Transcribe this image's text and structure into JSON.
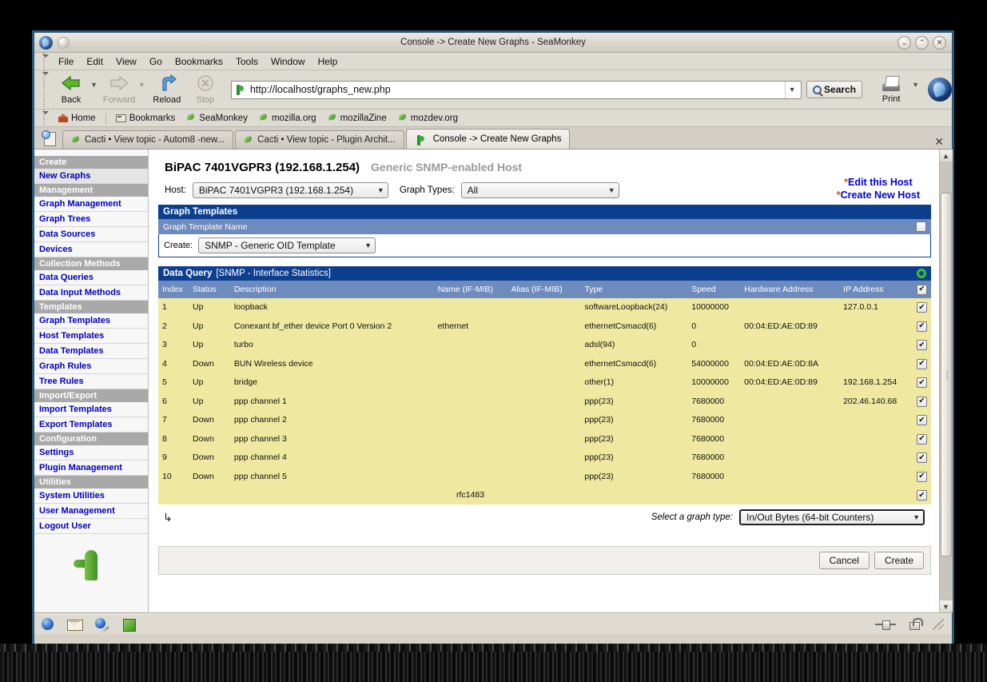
{
  "window": {
    "title": "Console -> Create New Graphs - SeaMonkey",
    "buttons": {
      "minimize": "⌄",
      "maximize": "⌃",
      "close": "✕"
    }
  },
  "menubar": {
    "items": [
      "File",
      "Edit",
      "View",
      "Go",
      "Bookmarks",
      "Tools",
      "Window",
      "Help"
    ]
  },
  "toolbar": {
    "back": "Back",
    "forward": "Forward",
    "reload": "Reload",
    "stop": "Stop",
    "url": "http://localhost/graphs_new.php",
    "search": "Search",
    "print": "Print"
  },
  "bookmarks": {
    "items": [
      "Home",
      "Bookmarks",
      "SeaMonkey",
      "mozilla.org",
      "mozillaZine",
      "mozdev.org"
    ]
  },
  "tabs": [
    {
      "label": "Cacti • View topic - Autom8 -new...",
      "active": false
    },
    {
      "label": "Cacti • View topic - Plugin Archit...",
      "active": false
    },
    {
      "label": "Console -> Create New Graphs",
      "active": true
    }
  ],
  "sidebar": {
    "items": [
      {
        "label": "Create",
        "type": "header"
      },
      {
        "label": "New Graphs",
        "type": "link",
        "current": true
      },
      {
        "label": "Management",
        "type": "header"
      },
      {
        "label": "Graph Management",
        "type": "link"
      },
      {
        "label": "Graph Trees",
        "type": "link"
      },
      {
        "label": "Data Sources",
        "type": "link"
      },
      {
        "label": "Devices",
        "type": "link"
      },
      {
        "label": "Collection Methods",
        "type": "header"
      },
      {
        "label": "Data Queries",
        "type": "link"
      },
      {
        "label": "Data Input Methods",
        "type": "link"
      },
      {
        "label": "Templates",
        "type": "header"
      },
      {
        "label": "Graph Templates",
        "type": "link"
      },
      {
        "label": "Host Templates",
        "type": "link"
      },
      {
        "label": "Data Templates",
        "type": "link"
      },
      {
        "label": "Graph Rules",
        "type": "link"
      },
      {
        "label": "Tree Rules",
        "type": "link"
      },
      {
        "label": "Import/Export",
        "type": "header"
      },
      {
        "label": "Import Templates",
        "type": "link"
      },
      {
        "label": "Export Templates",
        "type": "link"
      },
      {
        "label": "Configuration",
        "type": "header"
      },
      {
        "label": "Settings",
        "type": "link"
      },
      {
        "label": "Plugin Management",
        "type": "link"
      },
      {
        "label": "Utilities",
        "type": "header"
      },
      {
        "label": "System Utilities",
        "type": "link"
      },
      {
        "label": "User Management",
        "type": "link"
      },
      {
        "label": "Logout User",
        "type": "link"
      }
    ]
  },
  "main": {
    "host_title": "BiPAC 7401VGPR3 (192.168.1.254)",
    "host_subtitle": "Generic SNMP-enabled Host",
    "host_label": "Host:",
    "host_value": "BiPAC 7401VGPR3 (192.168.1.254)",
    "graph_types_label": "Graph Types:",
    "graph_types_value": "All",
    "edit_host_link": "Edit this Host",
    "create_host_link": "Create New Host",
    "star": "*",
    "graph_templates_title": "Graph Templates",
    "graph_template_name_col": "Graph Template Name",
    "create_label": "Create:",
    "create_value": "SNMP - Generic OID Template",
    "data_query_title": "Data Query",
    "data_query_subtitle": "[SNMP - Interface Statistics]",
    "select_graph_type_label": "Select a graph type:",
    "select_graph_type_value": "In/Out Bytes (64-bit Counters)",
    "cancel_button": "Cancel",
    "create_button": "Create",
    "check_mark": "✔"
  },
  "table": {
    "columns": [
      "Index",
      "Status",
      "Description",
      "Name (IF-MIB)",
      "Alias (IF-MIB)",
      "Type",
      "Speed",
      "Hardware Address",
      "IP Address"
    ],
    "rows": [
      {
        "index": "1",
        "status": "Up",
        "description": "loopback",
        "name": "",
        "alias": "",
        "type": "softwareLoopback(24)",
        "speed": "10000000",
        "hw": "",
        "ip": "127.0.0.1",
        "checked": true
      },
      {
        "index": "2",
        "status": "Up",
        "description": "Conexant bf_ether device Port 0 Version 2",
        "name": "ethernet",
        "alias": "",
        "type": "ethernetCsmacd(6)",
        "speed": "0",
        "hw": "00:04:ED:AE:0D:89",
        "ip": "",
        "checked": true
      },
      {
        "index": "3",
        "status": "Up",
        "description": "turbo",
        "name": "",
        "alias": "",
        "type": "adsl(94)",
        "speed": "0",
        "hw": "",
        "ip": "",
        "checked": true
      },
      {
        "index": "4",
        "status": "Down",
        "description": "BUN Wireless device",
        "name": "",
        "alias": "",
        "type": "ethernetCsmacd(6)",
        "speed": "54000000",
        "hw": "00:04:ED:AE:0D:8A",
        "ip": "",
        "checked": true
      },
      {
        "index": "5",
        "status": "Up",
        "description": "bridge",
        "name": "",
        "alias": "",
        "type": "other(1)",
        "speed": "10000000",
        "hw": "00:04:ED:AE:0D:89",
        "ip": "192.168.1.254",
        "checked": true
      },
      {
        "index": "6",
        "status": "Up",
        "description": "ppp channel 1",
        "name": "",
        "alias": "",
        "type": "ppp(23)",
        "speed": "7680000",
        "hw": "",
        "ip": "202.46.140.68",
        "checked": true
      },
      {
        "index": "7",
        "status": "Down",
        "description": "ppp channel 2",
        "name": "",
        "alias": "",
        "type": "ppp(23)",
        "speed": "7680000",
        "hw": "",
        "ip": "",
        "checked": true
      },
      {
        "index": "8",
        "status": "Down",
        "description": "ppp channel 3",
        "name": "",
        "alias": "",
        "type": "ppp(23)",
        "speed": "7680000",
        "hw": "",
        "ip": "",
        "checked": true
      },
      {
        "index": "9",
        "status": "Down",
        "description": "ppp channel 4",
        "name": "",
        "alias": "",
        "type": "ppp(23)",
        "speed": "7680000",
        "hw": "",
        "ip": "",
        "checked": true
      },
      {
        "index": "10",
        "status": "Down",
        "description": "ppp channel 5",
        "name": "",
        "alias": "",
        "type": "ppp(23)",
        "speed": "7680000",
        "hw": "",
        "ip": "",
        "checked": true
      },
      {
        "index": "",
        "status": "",
        "description": "",
        "name": "rfc1483",
        "alias": "",
        "type": "",
        "speed": "",
        "hw": "",
        "ip": "",
        "checked": true
      }
    ]
  },
  "colors": {
    "header_blue": "#0d3f8f",
    "subheader_blue": "#6e8bbd",
    "row_yellow": "#eee8a0",
    "link_blue": "#0000c0",
    "star_orange": "#c05a10",
    "green": "#3fbf2f"
  }
}
